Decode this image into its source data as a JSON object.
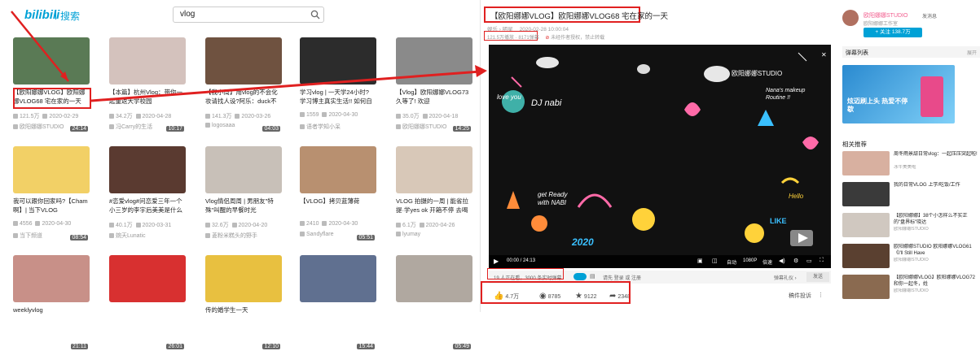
{
  "search": {
    "logo": "bilibili",
    "label": "搜索",
    "query": "vlog"
  },
  "videos": [
    {
      "title": "【欧阳娜娜VLOG】欧阳娜娜VLOG68 宅在家的一天",
      "duration": "24:14",
      "views": "121.5万",
      "date": "2020-02-29",
      "author": "欧阳娜娜STUDIO",
      "thumb_color": "#5a7a55"
    },
    {
      "title": "【本篇】杭州Vlog：带你一起重返大学校园",
      "duration": "10:17",
      "views": "34.2万",
      "date": "2020-04-28",
      "author": "冯Carry的生活",
      "thumb_color": "#d4c2bd"
    },
    {
      "title": "【我小周】用vlog的不会化妆请找人设?阿乐：duck不",
      "duration": "04:03",
      "views": "141.3万",
      "date": "2020-03-26",
      "author": "logosaaa",
      "thumb_color": "#6f5240"
    },
    {
      "title": "学习vlog | 一天学24小时? 学习博主真实生活!! 如何自",
      "duration": "",
      "views": "1559",
      "date": "2020-04-30",
      "author": "语者学知小呆",
      "thumb_color": "#2c2c2c"
    },
    {
      "title": "【Vlog】欧阳娜娜VLOG73 久等了! 欢迎",
      "duration": "14:25",
      "views": "35.0万",
      "date": "2020-04-18",
      "author": "欧阳娜娜STUDIO",
      "thumb_color": "#8a8a8a"
    },
    {
      "title": "我可以跟你回家吗?【Cham啊】| 当下VLOG",
      "duration": "08:54",
      "views": "4556",
      "date": "2020-04-30",
      "author": "当下频道",
      "thumb_color": "#f2d066"
    },
    {
      "title": "#恋爱vlog#问恋爱三年一个小三岁的李宇后美美是什么体",
      "duration": "",
      "views": "40.1万",
      "date": "2020-03-31",
      "author": "婉天Lunatic",
      "thumb_color": "#5a3a30"
    },
    {
      "title": "Vlog情侣周周 | 男朋友\"特殊\"叫醒的早餐时光",
      "duration": "",
      "views": "32.6万",
      "date": "2020-04-20",
      "author": "菱粉米糕头的野手",
      "thumb_color": "#c8c0b8"
    },
    {
      "title": "【VLOG】拷贝蓝薄荷",
      "duration": "05:51",
      "views": "2410",
      "date": "2020-04-30",
      "author": "Sandyflare",
      "thumb_color": "#b89070"
    },
    {
      "title": "VLOG 拍摄的一周 | 能省拉提·学yes ok 开箱不停 去喝",
      "duration": "",
      "views": "6.1万",
      "date": "2020-04-26",
      "author": "lyumay",
      "thumb_color": "#d8c8b8"
    },
    {
      "title": "weeklyvlog",
      "duration": "21:11",
      "views": "",
      "date": "",
      "author": "",
      "thumb_color": "#c89088"
    },
    {
      "title": "",
      "duration": "26:01",
      "views": "",
      "date": "",
      "author": "",
      "thumb_color": "#d83030"
    },
    {
      "title": "传的婚学生一天",
      "duration": "12:10",
      "views": "",
      "date": "",
      "author": "",
      "thumb_color": "#e8c040"
    },
    {
      "title": "",
      "duration": "15:44",
      "views": "",
      "date": "",
      "author": "",
      "thumb_color": "#607090"
    },
    {
      "title": "",
      "duration": "05:49",
      "views": "",
      "date": "",
      "author": "",
      "thumb_color": "#b0a8a0"
    }
  ],
  "video": {
    "title": "【欧阳娜娜VLOG】欧阳娜娜VLOG68 宅在家的一天",
    "category": "娱乐 › 明星",
    "date": "2020-02-28 10:00:04",
    "views": "121.5万播放 · 8171弹幕",
    "notice": "未经作者授权，禁止转载",
    "watermark": "欧阳娜娜STUDIO",
    "current_time": "00:00 / 24:13",
    "ctrl_auto": "自动",
    "ctrl_quality": "1080P",
    "ctrl_speed": "倍速",
    "watching": "19 人正在看，3000 条实时弹幕",
    "danmaku_hint": "请先 登录 或 注册",
    "danmaku_gift": "弹幕礼仪 ›",
    "danmaku_send": "发送",
    "likes": "4.7万",
    "coins": "8785",
    "favs": "9122",
    "shares": "2348",
    "report": "稿件投诉",
    "stickers": [
      "love you",
      "DJ nabi",
      "Nana's makeup Routine !!",
      "get Ready with NABI",
      "LIKE",
      "Hello",
      "2020"
    ]
  },
  "uploader": {
    "name": "欧阳娜娜STUDIO",
    "message": "发消息",
    "desc": "欧阳娜娜工作室",
    "follow": "+ 关注 138.7万"
  },
  "sidebar": {
    "danmaku_list": "弹幕列表",
    "expand": "展开",
    "ad_text": "炫迈刷上头 热爱不停歇",
    "related_title": "相关推荐",
    "related": [
      {
        "title": "周冬雨景甜日常vlog：一起压压突起啦!",
        "author": "冰牛美美啦",
        "stats": "32.6万播放 · 6234弹幕",
        "color": "#d8b0a0"
      },
      {
        "title": "我的日常VLOG 上学/吃饭/工作",
        "author": "",
        "stats": "",
        "color": "#3a3a3a"
      },
      {
        "title": "【欧阳娜娜】38个小怎样么不实正的\"盘界标\"晓达",
        "author": "欧阳娜娜STUDIO",
        "stats": "",
        "color": "#d0c8c0"
      },
      {
        "title": "欧阳娜娜STUDIO 欧阳娜娜VLOG61《I'll Still Have",
        "author": "欧阳娜娜STUDIO",
        "stats": "",
        "color": "#5a4030"
      },
      {
        "title": "【欧阳娜娜VLOG】欧阳娜娜VLOG72 和你一起冬，姓",
        "author": "欧阳娜娜STUDIO",
        "stats": "",
        "color": "#8a6a50"
      }
    ]
  }
}
